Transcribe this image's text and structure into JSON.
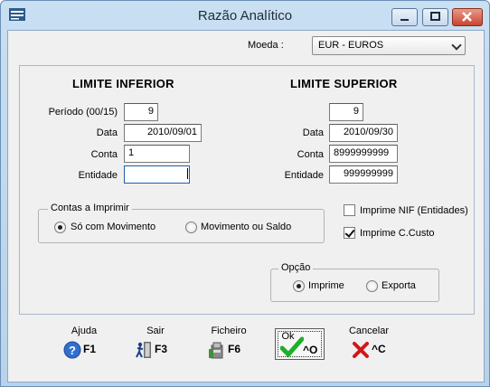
{
  "window": {
    "title": "Razão Analítico"
  },
  "moeda": {
    "label": "Moeda :",
    "value": "EUR - EUROS"
  },
  "limite_inferior": {
    "heading": "LIMITE INFERIOR",
    "periodo_label": "Período (00/15)",
    "periodo": "9",
    "data_label": "Data",
    "data": "2010/09/01",
    "conta_label": "Conta",
    "conta": "1",
    "entidade_label": "Entidade",
    "entidade": ""
  },
  "limite_superior": {
    "heading": "LIMITE SUPERIOR",
    "periodo": "9",
    "data_label": "Data",
    "data": "2010/09/30",
    "conta_label": "Conta",
    "conta": "8999999999",
    "entidade_label": "Entidade",
    "entidade": "999999999"
  },
  "contas": {
    "legend": "Contas a Imprimir",
    "options": [
      {
        "label": "Só com Movimento",
        "selected": true
      },
      {
        "label": "Movimento ou Saldo",
        "selected": false
      }
    ]
  },
  "checks": [
    {
      "label": "Imprime NIF (Entidades)",
      "checked": false
    },
    {
      "label": "Imprime C.Custo",
      "checked": true
    }
  ],
  "opcao": {
    "legend": "Opção",
    "options": [
      {
        "label": "Imprime",
        "selected": true
      },
      {
        "label": "Exporta",
        "selected": false
      }
    ]
  },
  "toolbar": [
    {
      "label": "Ajuda",
      "key": "F1",
      "icon": "help-icon"
    },
    {
      "label": "Sair",
      "key": "F3",
      "icon": "exit-icon"
    },
    {
      "label": "Ficheiro",
      "key": "F6",
      "icon": "file-icon"
    },
    {
      "label": "Ok",
      "key": "^O",
      "icon": "checkmark-icon"
    },
    {
      "label": "Cancelar",
      "key": "^C",
      "icon": "cross-icon"
    }
  ]
}
